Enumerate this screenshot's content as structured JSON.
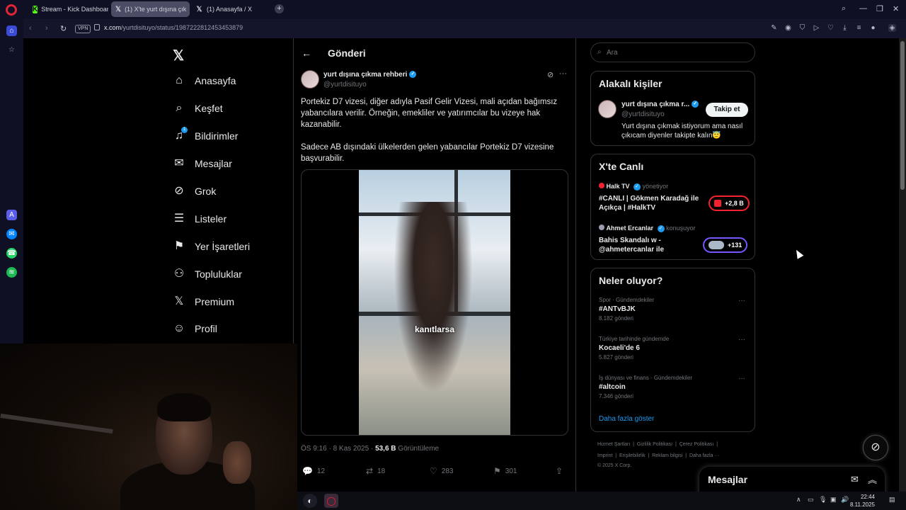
{
  "browser": {
    "tabs": [
      {
        "label": "Stream - Kick Dashboard",
        "favicon": "kick-icon"
      },
      {
        "label": "(1) X'te yurt dışına çık",
        "favicon": "x-icon"
      },
      {
        "label": "(1) Anasayfa / X",
        "favicon": "x-icon"
      }
    ],
    "vpn_label": "VPN",
    "url_host": "x.com",
    "url_path": "/yurtdisituyo/status/1987222812453453879"
  },
  "nav": {
    "items": [
      {
        "label": "Anasayfa",
        "icon": "home-icon"
      },
      {
        "label": "Keşfet",
        "icon": "search-icon"
      },
      {
        "label": "Bildirimler",
        "icon": "bell-icon",
        "badge": "1"
      },
      {
        "label": "Mesajlar",
        "icon": "mail-icon"
      },
      {
        "label": "Grok",
        "icon": "grok-icon"
      },
      {
        "label": "Listeler",
        "icon": "list-icon"
      },
      {
        "label": "Yer İşaretleri",
        "icon": "bookmark-icon"
      },
      {
        "label": "Topluluklar",
        "icon": "communities-icon"
      },
      {
        "label": "Premium",
        "icon": "x-icon"
      },
      {
        "label": "Profil",
        "icon": "user-icon"
      }
    ]
  },
  "post": {
    "header_title": "Gönderi",
    "author_name": "yurt dışına çıkma rehberi",
    "author_handle": "@yurtdisituyo",
    "text_p1": "Portekiz D7 vizesi, diğer adıyla Pasif Gelir Vizesi, mali açıdan bağımsız yabancılara verilir. Örneğin, emekliler ve yatırımcılar bu vizeye hak kazanabilir.",
    "text_p2": "Sadece AB dışındaki ülkelerden gelen yabancılar Portekiz D7 vizesine başvurabilir.",
    "video_caption": "kanıtlarsa",
    "time": "ÖS 9:16 · 8 Kas 2025 · ",
    "views_count": "53,6 B",
    "views_label": " Görüntüleme",
    "replies": "12",
    "reposts": "18",
    "likes": "283",
    "bookmarks": "301"
  },
  "right": {
    "search_placeholder": "Ara",
    "related_title": "Alakalı kişiler",
    "related_name": "yurt dışına çıkma r...",
    "related_handle": "@yurtdisituyo",
    "follow_label": "Takip et",
    "related_bio": "Yurt dışına çıkmak istiyorum ama nasıl çıkıcam diyenler takipte kalın😇",
    "live_title": "X'te Canlı",
    "live": [
      {
        "host": "Halk TV",
        "role": "yönetiyor",
        "title": "#CANLI | Gökmen Karadağ ile Açıkça | #HalkTV",
        "count": "+2,8 B",
        "color": "#f4212e"
      },
      {
        "host": "Ahmet Ercanlar",
        "role": "konuşuyor",
        "title": "Bahis Skandalı w - @ahmetercanlar ile",
        "count": "+131",
        "color": "#7856ff"
      }
    ],
    "trends_title": "Neler oluyor?",
    "trends": [
      {
        "context": "Spor · Gündemdekiler",
        "name": "#ANTvBJK",
        "count": "8.182 gönderi"
      },
      {
        "context": "Türkiye tarihinde gündemde",
        "name": "Kocaeli'de 6",
        "count": "5.827 gönderi"
      },
      {
        "context": "İş dünyası ve finans · Gündemdekiler",
        "name": "#altcoin",
        "count": "7.346 gönderi"
      }
    ],
    "show_more": "Daha fazla göster",
    "footer_line1": [
      "Hizmet Şartları",
      "Gizlilik Politikası",
      "Çerez Politikası"
    ],
    "footer_line2": [
      "Imprint",
      "Erişilebilirlik",
      "Reklam bilgisi",
      "Daha fazla ···"
    ],
    "footer_copy": "© 2025 X Corp."
  },
  "messages_drawer": {
    "title": "Mesajlar"
  },
  "taskbar": {
    "time": "22:44",
    "date": "8.11.2025"
  },
  "colors": {
    "accent": "#1d9bf0",
    "bg": "#000000",
    "border": "#2f3336",
    "muted": "#71767b"
  }
}
